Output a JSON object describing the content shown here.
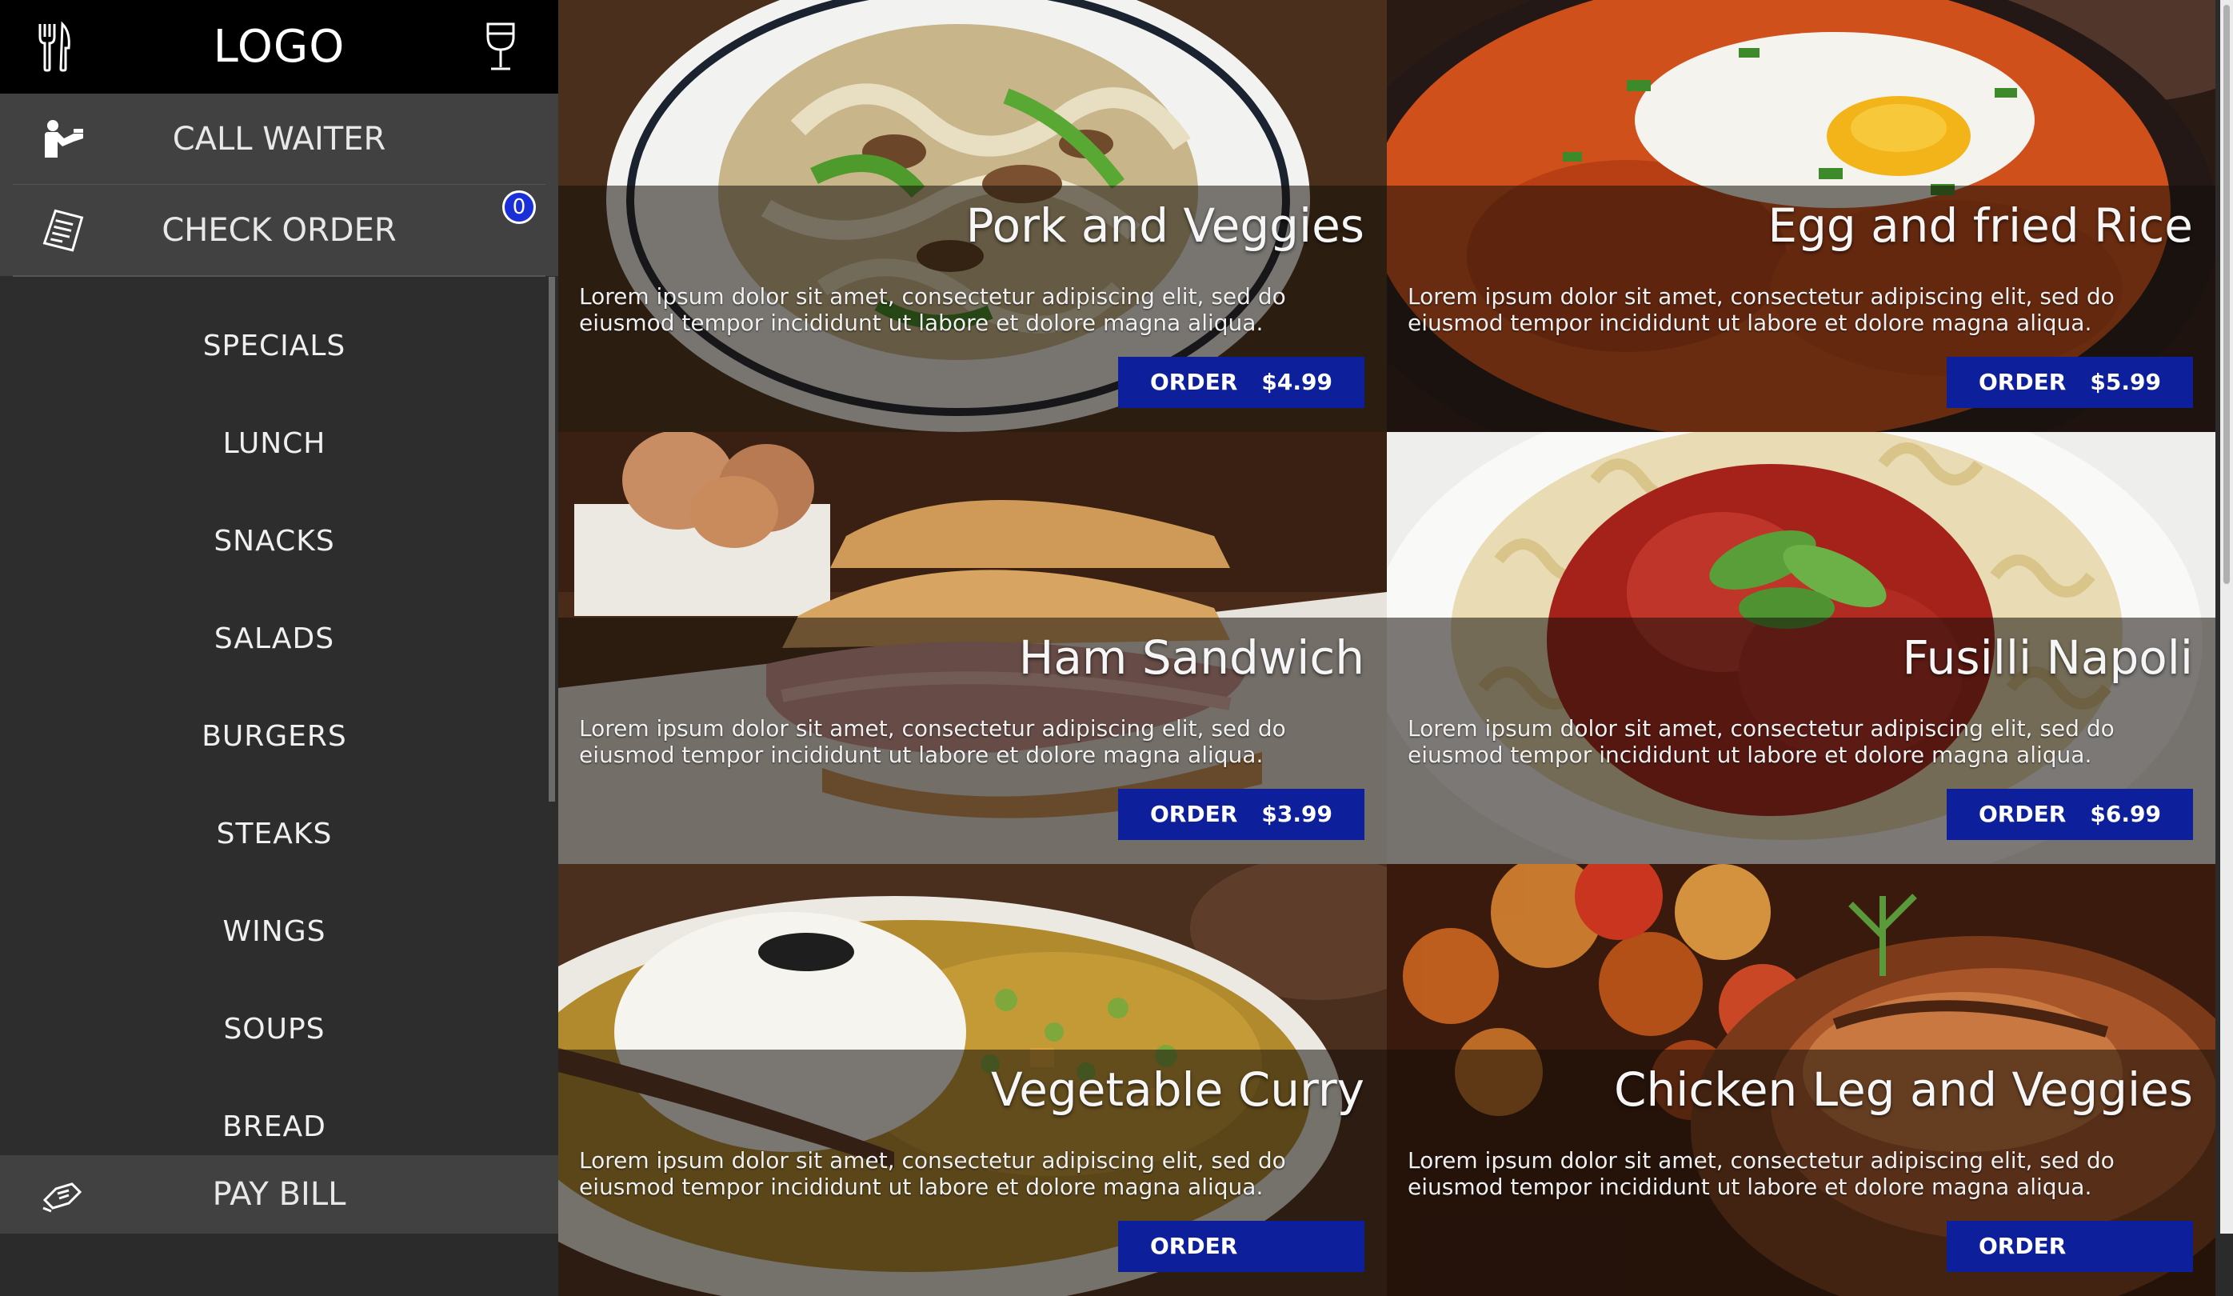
{
  "header": {
    "logo_text": "LOGO",
    "left_icon": "fork-knife-icon",
    "right_icon": "wine-glass-icon"
  },
  "actions": {
    "call_waiter": {
      "label": "CALL WAITER",
      "icon": "waiter-icon"
    },
    "check_order": {
      "label": "CHECK ORDER",
      "icon": "receipt-icon",
      "badge": "0"
    },
    "pay_bill": {
      "label": "PAY BILL",
      "icon": "cash-hand-icon"
    }
  },
  "categories": [
    "SPECIALS",
    "LUNCH",
    "SNACKS",
    "SALADS",
    "BURGERS",
    "STEAKS",
    "WINGS",
    "SOUPS",
    "BREAD"
  ],
  "menu": {
    "items": [
      {
        "name": "Pork and Veggies",
        "desc": "Lorem ipsum dolor sit amet, consectetur adipiscing elit, sed do eiusmod tempor incididunt ut labore et dolore magna aliqua.",
        "order_label": "ORDER",
        "price": "$4.99"
      },
      {
        "name": "Egg and fried Rice",
        "desc": "Lorem ipsum dolor sit amet, consectetur adipiscing elit, sed do eiusmod tempor incididunt ut labore et dolore magna aliqua.",
        "order_label": "ORDER",
        "price": "$5.99"
      },
      {
        "name": "Ham Sandwich",
        "desc": "Lorem ipsum dolor sit amet, consectetur adipiscing elit, sed do eiusmod tempor incididunt ut labore et dolore magna aliqua.",
        "order_label": "ORDER",
        "price": "$3.99"
      },
      {
        "name": "Fusilli Napoli",
        "desc": "Lorem ipsum dolor sit amet, consectetur adipiscing elit, sed do eiusmod tempor incididunt ut labore et dolore magna aliqua.",
        "order_label": "ORDER",
        "price": "$6.99"
      },
      {
        "name": "Vegetable Curry",
        "desc": "Lorem ipsum dolor sit amet, consectetur adipiscing elit, sed do eiusmod tempor incididunt ut labore et dolore magna aliqua.",
        "order_label": "ORDER",
        "price": ""
      },
      {
        "name": "Chicken Leg and Veggies",
        "desc": "Lorem ipsum dolor sit amet, consectetur adipiscing elit, sed do eiusmod tempor incididunt ut labore et dolore magna aliqua.",
        "order_label": "ORDER",
        "price": ""
      }
    ]
  },
  "colors": {
    "accent": "#0d1f9a",
    "badge": "#1a2fd8",
    "sidebar": "#2d2d2d",
    "action_bg": "#414141"
  }
}
